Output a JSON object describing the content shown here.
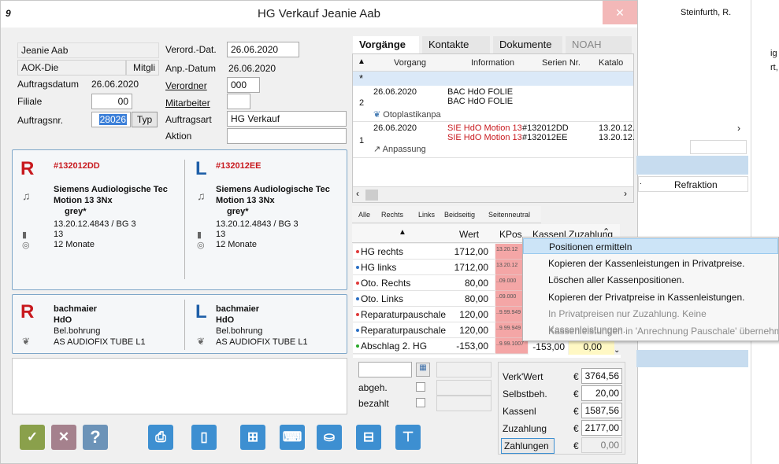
{
  "window": {
    "title": "HG Verkauf Jeanie Aab",
    "app_icon_glyph": "9",
    "close_glyph": "✕"
  },
  "background": {
    "name": "Steinfurth, R.",
    "frag1": "ig",
    "frag2": "rt,"
  },
  "form": {
    "customer_name": "Jeanie Aab",
    "insurance": "AOK-Die",
    "insurance_type": "Mitgli",
    "auftragsdatum_label": "Auftragsdatum",
    "auftragsdatum": "26.06.2020",
    "filiale_label": "Filiale",
    "filiale": "00",
    "auftragsnr_label": "Auftragsnr.",
    "auftragsnr": "28026",
    "typ_button": "Typ",
    "verord_dat_label": "Verord.-Dat.",
    "verord_dat": "26.06.2020",
    "anp_datum_label": "Anp.-Datum",
    "anp_datum": "26.06.2020",
    "verordner_label": "Verordner",
    "verordner": "000",
    "mitarbeiter_label": "Mitarbeiter",
    "mitarbeiter": "",
    "auftragsart_label": "Auftragsart",
    "auftragsart": "HG Verkauf",
    "aktion_label": "Aktion",
    "aktion": ""
  },
  "devices": {
    "right": {
      "side": "R",
      "serial": "#132012DD",
      "manufacturer": "Siemens Audiologische Tec",
      "model": "Motion 13 3Nx",
      "color": "grey*",
      "code": "13.20.12.4843 / BG 3",
      "battery": "13",
      "warranty": "12 Monate"
    },
    "left": {
      "side": "L",
      "serial": "#132012EE",
      "manufacturer": "Siemens Audiologische Tec",
      "model": "Motion 13 3Nx",
      "color": "grey*",
      "code": "13.20.12.4843 / BG 3",
      "battery": "13",
      "warranty": "12 Monate"
    }
  },
  "otoplastics": {
    "right": {
      "side": "R",
      "maker": "bachmaier",
      "type": "HdO",
      "bore": "Bel.bohrung",
      "tube": "AS AUDIOFIX TUBE L1"
    },
    "left": {
      "side": "L",
      "maker": "bachmaier",
      "type": "HdO",
      "bore": "Bel.bohrung",
      "tube": "AS AUDIOFIX TUBE L1"
    }
  },
  "tabs": [
    {
      "label": "Vorgänge",
      "active": true
    },
    {
      "label": "Kontakte",
      "active": false
    },
    {
      "label": "Dokumente",
      "active": false
    },
    {
      "label": "NOAH",
      "active": false
    }
  ],
  "vorgaenge": {
    "columns": [
      "Vorgang",
      "Information",
      "Serien Nr.",
      "Katalo"
    ],
    "new_row_marker": "*",
    "rows": [
      {
        "num": "2",
        "date": "26.06.2020",
        "sub": "Otoplastikanpa",
        "info1": "BAC HdO FOLIE",
        "info2": "BAC HdO FOLIE",
        "serial1": "",
        "serial2": "",
        "kat1": "",
        "kat2": ""
      },
      {
        "num": "1",
        "date": "26.06.2020",
        "sub": "Anpassung",
        "info1": "SIE HdO Motion 13",
        "info2": "SIE HdO Motion 13",
        "serial1": "#132012DD",
        "serial2": "#132012EE",
        "kat1": "13.20.12.",
        "kat2": "13.20.12."
      }
    ]
  },
  "subtabs": [
    "Alle",
    "Rechts",
    "Links",
    "Beidseitig",
    "Seitenneutral"
  ],
  "positions": {
    "columns": [
      "Wert",
      "KPos",
      "Kassenl",
      "Zuzahlung"
    ],
    "rows": [
      {
        "name": "HG rechts",
        "value": "1712,00",
        "kpos": "13.20.12",
        "dot": "#e03a3a"
      },
      {
        "name": "HG links",
        "value": "1712,00",
        "kpos": "13.20.12",
        "dot": "#2b6fc4"
      },
      {
        "name": "Oto. Rechts",
        "value": "80,00",
        "kpos": "..09.000",
        "dot": "#e03a3a"
      },
      {
        "name": "Oto. Links",
        "value": "80,00",
        "kpos": "..09.000",
        "dot": "#2b6fc4"
      },
      {
        "name": "Reparaturpauschale",
        "value": "120,00",
        "kpos": "..9.99.949",
        "dot": "#e03a3a"
      },
      {
        "name": "Reparaturpauschale",
        "value": "120,00",
        "kpos": "..9.99.949",
        "dot": "#2b6fc4"
      },
      {
        "name": "Abschlag 2. HG",
        "value": "-153,00",
        "kpos": "..9.99.1007",
        "dot": "#2aa82a",
        "kassenl": "-153,00",
        "zuzahlung": "0,00"
      }
    ]
  },
  "context_menu": [
    {
      "label": "Positionen ermitteln",
      "highlighted": true,
      "disabled": false
    },
    {
      "label": "Kopieren der Kassenleistungen in Privatpreise.",
      "highlighted": false,
      "disabled": false
    },
    {
      "label": "Löschen aller Kassenpositionen.",
      "highlighted": false,
      "disabled": false
    },
    {
      "label": "Kopieren der Privatpreise in Kassenleistungen.",
      "highlighted": false,
      "disabled": false
    },
    {
      "label": "In Privatpreisen nur Zuzahlung. Keine Kassenleistungen.",
      "highlighted": false,
      "disabled": true
    },
    {
      "label": "Kassenleistungen in 'Anrechnung Pauschale' übernehmen",
      "highlighted": false,
      "disabled": true
    }
  ],
  "payment": {
    "abgeh_label": "abgeh.",
    "bezahlt_label": "bezahlt"
  },
  "totals": {
    "currency": "€",
    "verkwert_label": "Verk'Wert",
    "verkwert": "3764,56",
    "selbstbeh_label": "Selbstbeh.",
    "selbstbeh": "20,00",
    "kassenl_label": "Kassenl",
    "kassenl": "1587,56",
    "zuzahlung_label": "Zuzahlung",
    "zuzahlung": "2177,00",
    "zahlungen_button": "Zahlungen",
    "zahlungen": "0,00"
  },
  "refraktion_label": "Refraktion",
  "colors": {
    "accent_blue": "#3d8fd1",
    "right_red": "#c8191e",
    "left_blue": "#1f5fa8",
    "kpos_red": "#f4a6a6",
    "ok_green": "#8aa04b",
    "cancel_mauve": "#a5818d",
    "help_blue": "#6c93b8"
  }
}
